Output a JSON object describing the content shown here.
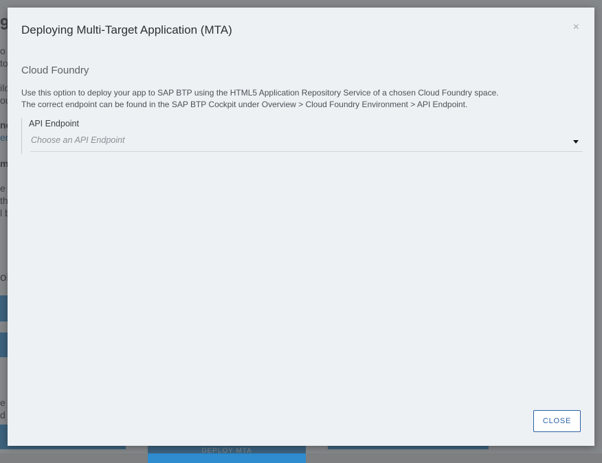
{
  "background": {
    "fragments": {
      "title_char": "9",
      "t1": "o p",
      "t2": "to",
      "t3": "ilc",
      "t4": "ou",
      "t5": "nc",
      "t6": "er",
      "t7": "m",
      "t8": "e",
      "t9": "th",
      "t10": "l b",
      "t11": "ob",
      "t12": "e",
      "t13": "d",
      "deploy_button": "DEPLOY MTA"
    }
  },
  "modal": {
    "title": "Deploying Multi-Target Application (MTA)",
    "close_icon": "×",
    "section_title": "Cloud Foundry",
    "description_line1": "Use this option to deploy your app to SAP BTP using the HTML5 Application Repository Service of a chosen Cloud Foundry space.",
    "description_line2": "The correct endpoint can be found in the SAP BTP Cockpit under Overview > Cloud Foundry Environment > API Endpoint.",
    "api_endpoint": {
      "label": "API Endpoint",
      "placeholder": "Choose an API Endpoint"
    },
    "close_button": "CLOSE"
  },
  "icons": {
    "close": "close-icon",
    "dropdown": "caret-down-icon"
  },
  "colors": {
    "accent": "#2a62a6",
    "bg_button_blue": "#2e8ccf"
  }
}
